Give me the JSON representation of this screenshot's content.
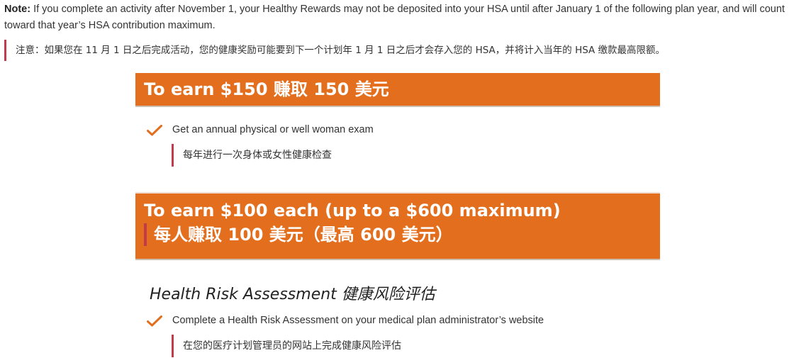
{
  "note": {
    "label": "Note:",
    "text_en": " If you complete an activity after November 1, your Healthy Rewards may not be deposited into your HSA until after January 1 of the following plan year, and will count toward that year’s HSA contribution maximum.",
    "text_zh": "注意：如果您在 11 月 1 日之后完成活动，您的健康奖励可能要到下一个计划年 1 月 1 日之后才会存入您的 HSA，并将计入当年的 HSA 缴款最高限额。"
  },
  "section_150": {
    "banner": "To earn $150 赚取 150 美元",
    "item_en": "Get an annual physical or well woman exam",
    "item_zh": "每年进行一次身体或女性健康检查"
  },
  "section_100": {
    "banner_en": "To earn $100 each (up to a $600 maximum)",
    "banner_zh": "每人赚取 100 美元（最高 600 美元）",
    "subsection_title": "Health Risk Assessment 健康风险评估",
    "item_en": "Complete a Health Risk Assessment on your medical plan administrator’s website",
    "item_zh": "在您的医疗计划管理员的网站上完成健康风险评估"
  },
  "colors": {
    "banner_orange": "#e36f1e",
    "accent_red": "#c23a4b",
    "check_orange": "#e36f1e"
  },
  "icons": {
    "check": "check-icon"
  }
}
